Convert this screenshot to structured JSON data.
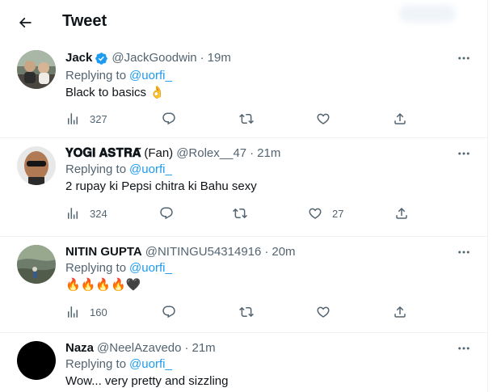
{
  "header": {
    "title": "Tweet"
  },
  "tweets": [
    {
      "name": "Jack",
      "verified": true,
      "handle": "@JackGoodwin",
      "time": "19m",
      "replying_label": "Replying to",
      "replying_to": "@uorfi_",
      "text": "Black to basics",
      "text_emoji": "👌",
      "stats": {
        "views": "327",
        "replies": "",
        "retweets": "",
        "likes": ""
      }
    },
    {
      "name": "𝐘𝐎𝐆𝐈 𝐀𝐒𝐓𝐑𝐀̃",
      "name_suffix": "(Fan)",
      "handle": "@Rolex__47",
      "time": "21m",
      "replying_label": "Replying to",
      "replying_to": "@uorfi_",
      "text": "2 rupay ki Pepsi chitra ki Bahu sexy",
      "stats": {
        "views": "324",
        "replies": "",
        "retweets": "",
        "likes": "27"
      }
    },
    {
      "name": "NITIN GUPTA",
      "handle": "@NITINGU54314916",
      "time": "20m",
      "replying_label": "Replying to",
      "replying_to": "@uorfi_",
      "text_emoji": "🔥🔥🔥🔥🖤",
      "stats": {
        "views": "160",
        "replies": "",
        "retweets": "",
        "likes": ""
      }
    },
    {
      "name": "Naza",
      "handle": "@NeelAzavedo",
      "time": "21m",
      "replying_label": "Replying to",
      "replying_to": "@uorfi_",
      "text": "Wow... very pretty and sizzling"
    }
  ],
  "colors": {
    "link": "#1d9bf0",
    "muted": "#536471",
    "text": "#0f1419",
    "border": "#eff3f4"
  },
  "icons": [
    "back-arrow-icon",
    "verified-badge-icon",
    "views-icon",
    "reply-icon",
    "retweet-icon",
    "like-icon",
    "share-icon",
    "more-icon"
  ]
}
